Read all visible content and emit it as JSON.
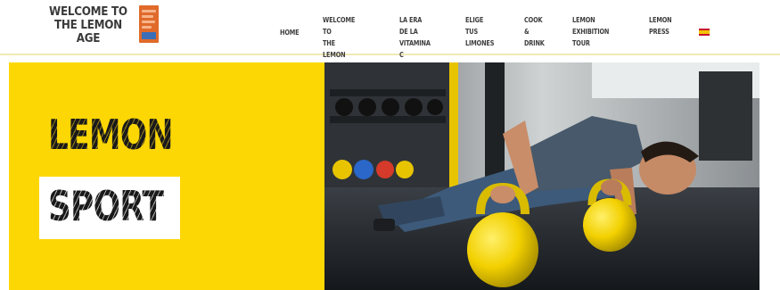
{
  "header": {
    "logo_text": "WELCOME TO\nTHE LEMON AGE",
    "nav": [
      {
        "label": "HOME"
      },
      {
        "label": "WELCOME TO\nTHE LEMON AGE"
      },
      {
        "label": "LA ERA DE LA\nVITAMINA C"
      },
      {
        "label": "ELIGE TUS\nLIMONES"
      },
      {
        "label": "COOK &\nDRINK"
      },
      {
        "label": "LEMON\nEXHIBITION TOUR"
      },
      {
        "label": "LEMON\nPRESS"
      }
    ],
    "language_flag": "spain-flag-icon"
  },
  "hero": {
    "title_line1": "LEMON",
    "title_line2": "SPORT",
    "background_color": "#fdd703",
    "image": "man-doing-kettlebell-pushups"
  },
  "colors": {
    "accent": "#fdd703",
    "text": "#3d3d3d",
    "logo_orange": "#e06a2a"
  }
}
